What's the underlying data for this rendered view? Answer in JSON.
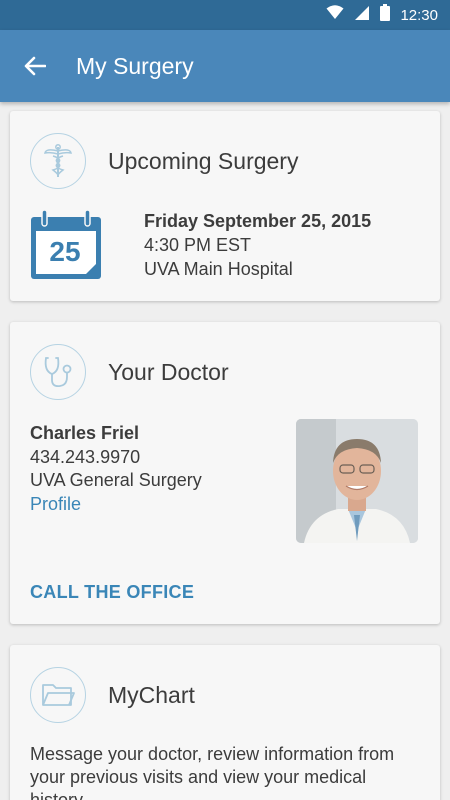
{
  "status_bar": {
    "time": "12:30",
    "icons": [
      "wifi-icon",
      "signal-icon",
      "battery-icon"
    ]
  },
  "app_bar": {
    "title": "My Surgery",
    "back_icon": "arrow-left-icon"
  },
  "surgery_card": {
    "title": "Upcoming Surgery",
    "icon": "caduceus-icon",
    "calendar_day": "25",
    "date": "Friday September 25, 2015",
    "time": "4:30 PM EST",
    "location": "UVA Main Hospital"
  },
  "doctor_card": {
    "title": "Your Doctor",
    "icon": "stethoscope-icon",
    "name": "Charles Friel",
    "phone": "434.243.9970",
    "department": "UVA General Surgery",
    "profile_link": "Profile",
    "call_action": "CALL THE OFFICE"
  },
  "mychart_card": {
    "title": "MyChart",
    "icon": "folder-icon",
    "description": "Message your doctor, review information from your previous visits and view your medical history"
  },
  "colors": {
    "status_bar": "#2f6a96",
    "app_bar": "#4a87ba",
    "accent": "#3a86b7",
    "background": "#efefef",
    "card": "#f7f7f7"
  }
}
